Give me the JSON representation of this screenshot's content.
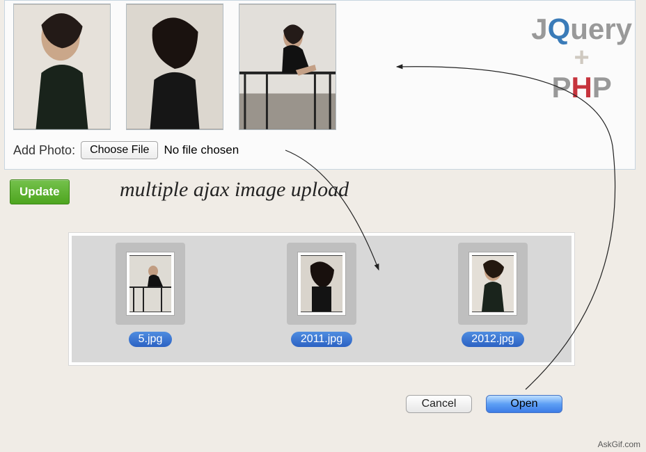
{
  "logo": {
    "j": "J",
    "q": "Q",
    "uery": "uery",
    "plus": "+",
    "p": "P",
    "h": "H",
    "p2": "P"
  },
  "addPhotoLabel": "Add Photo:",
  "chooseFileLabel": "Choose File",
  "noFileText": "No file chosen",
  "updateLabel": "Update",
  "cursiveText": "multiple ajax image upload",
  "files": [
    {
      "name": "5.jpg"
    },
    {
      "name": "2011.jpg"
    },
    {
      "name": "2012.jpg"
    }
  ],
  "cancelLabel": "Cancel",
  "openLabel": "Open",
  "watermark": "AskGif.com"
}
